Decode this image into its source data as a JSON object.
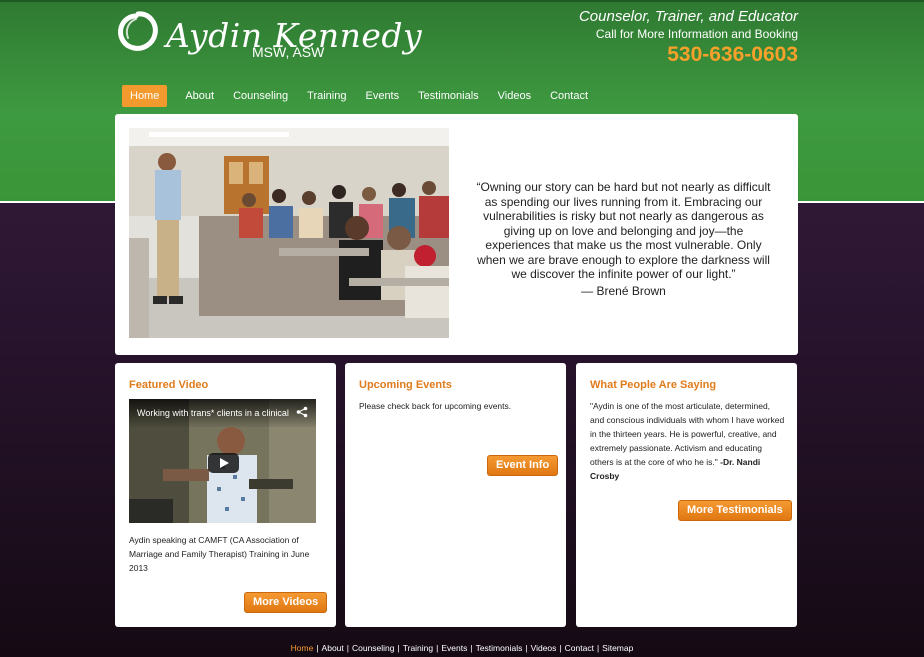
{
  "header": {
    "logo_name": "Aydin Kennedy",
    "logo_credentials": "MSW, ASW",
    "tagline": "Counselor, Trainer, and Educator",
    "call_info": "Call for More Information and Booking",
    "phone": "530-636-0603"
  },
  "nav": {
    "items": [
      {
        "label": "Home",
        "active": true
      },
      {
        "label": "About"
      },
      {
        "label": "Counseling"
      },
      {
        "label": "Training"
      },
      {
        "label": "Events"
      },
      {
        "label": "Testimonials"
      },
      {
        "label": "Videos"
      },
      {
        "label": "Contact"
      }
    ]
  },
  "hero": {
    "quote": "“Owning our story can be hard but not nearly as difficult as spending our lives running from it. Embracing our vulnerabilities is risky but not nearly as dangerous as giving up on love and belonging and joy—the experiences that make us the most vulnerable. Only when we are brave enough to explore the darkness will we discover the infinite power of our light.”",
    "author": "— Brené Brown"
  },
  "featured_video": {
    "title": "Featured Video",
    "video_title": "Working with trans* clients in a clinical...",
    "caption": "Aydin speaking at CAMFT (CA Association of Marriage and Family Therapist) Training in June 2013",
    "button": "More Videos"
  },
  "upcoming_events": {
    "title": "Upcoming Events",
    "text": "Please check back for upcoming events.",
    "button": "Event Info"
  },
  "testimonials": {
    "title": "What People Are Saying",
    "quote": "\"Aydin is one of the most articulate, determined, and conscious individuals with whom I have worked in the thirteen years. He is powerful, creative, and extremely passionate. Activism and educating others is at the core of who he is.\"",
    "author": "-Dr. Nandi Crosby",
    "button": "More Testimonials"
  },
  "footer": {
    "links": [
      "Home",
      "About",
      "Counseling",
      "Training",
      "Events",
      "Testimonials",
      "Videos",
      "Contact",
      "Sitemap"
    ],
    "separator": "|"
  },
  "colors": {
    "green": "#3e9a40",
    "purple": "#3a1f3f",
    "accent_orange": "#f39a2e",
    "phone_orange": "#f7a12a"
  }
}
